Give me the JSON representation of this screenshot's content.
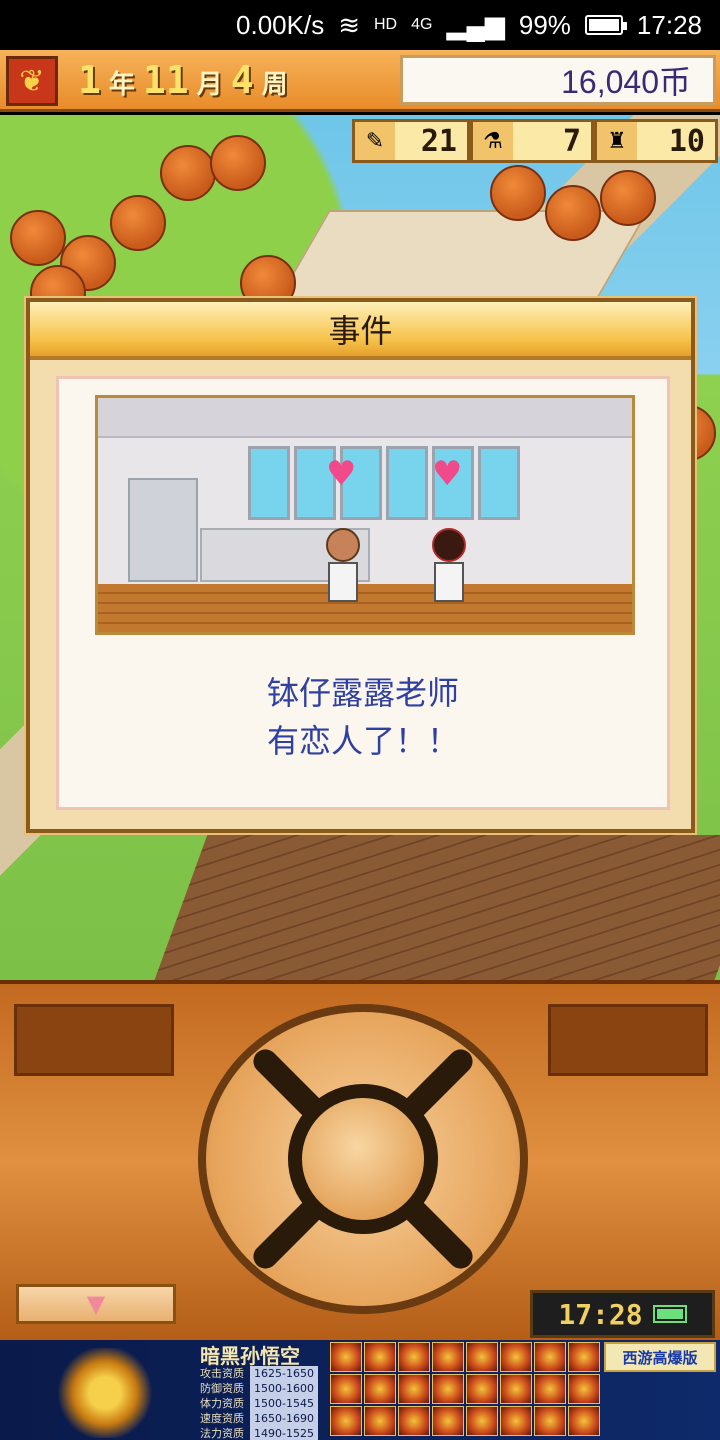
{
  "status_bar": {
    "net_speed": "0.00K/s",
    "hd_label": "HD",
    "network": "4G",
    "battery_percent": "99%",
    "battery_level": 0.99,
    "time": "17:28"
  },
  "hud": {
    "year": "1",
    "year_unit": "年",
    "month": "11",
    "month_unit": "月",
    "week": "4",
    "week_unit": "周",
    "money": "16,040币",
    "stats": [
      {
        "icon": "pencil-icon",
        "glyph": "✎",
        "value": "21"
      },
      {
        "icon": "flask-icon",
        "glyph": "⚗",
        "value": "7"
      },
      {
        "icon": "trophy-icon",
        "glyph": "♜",
        "value": "10"
      }
    ]
  },
  "event_dialog": {
    "title": "事件",
    "message_line1": "钵仔露露老师",
    "message_line2": "有恋人了！！"
  },
  "controller": {
    "menu_arrow": "▼",
    "clock_time": "17:28"
  },
  "ad": {
    "title": "暗黑孙悟空",
    "rows": [
      {
        "label": "攻击资质",
        "value": "1625-1650"
      },
      {
        "label": "防御资质",
        "value": "1500-1600"
      },
      {
        "label": "体力资质",
        "value": "1500-1545"
      },
      {
        "label": "速度资质",
        "value": "1650-1690"
      },
      {
        "label": "法力资质",
        "value": "1490-1525"
      }
    ],
    "brand": "西游高爆版"
  }
}
